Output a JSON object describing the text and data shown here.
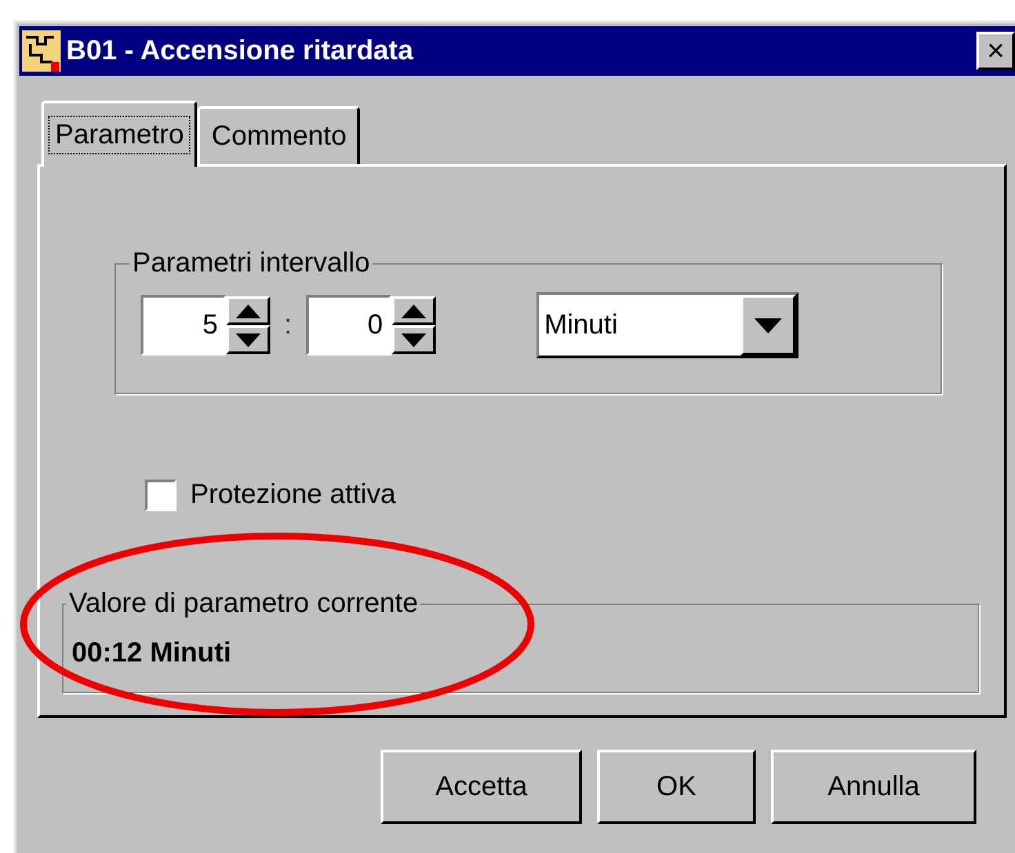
{
  "window": {
    "title": "B01 - Accensione ritardata",
    "close": "×"
  },
  "tabs": [
    {
      "label": "Parametro",
      "selected": true
    },
    {
      "label": "Commento",
      "selected": false
    }
  ],
  "interval_group": {
    "label": "Parametri intervallo",
    "spinners": [
      {
        "value": "5"
      },
      {
        "value": "0"
      }
    ],
    "separator": ":",
    "unit": "Minuti"
  },
  "protection": {
    "label": "Protezione attiva",
    "checked": false
  },
  "current_value": {
    "label": "Valore di parametro corrente",
    "value": "00:12 Minuti"
  },
  "buttons": [
    "Accetta",
    "OK",
    "Annulla"
  ]
}
